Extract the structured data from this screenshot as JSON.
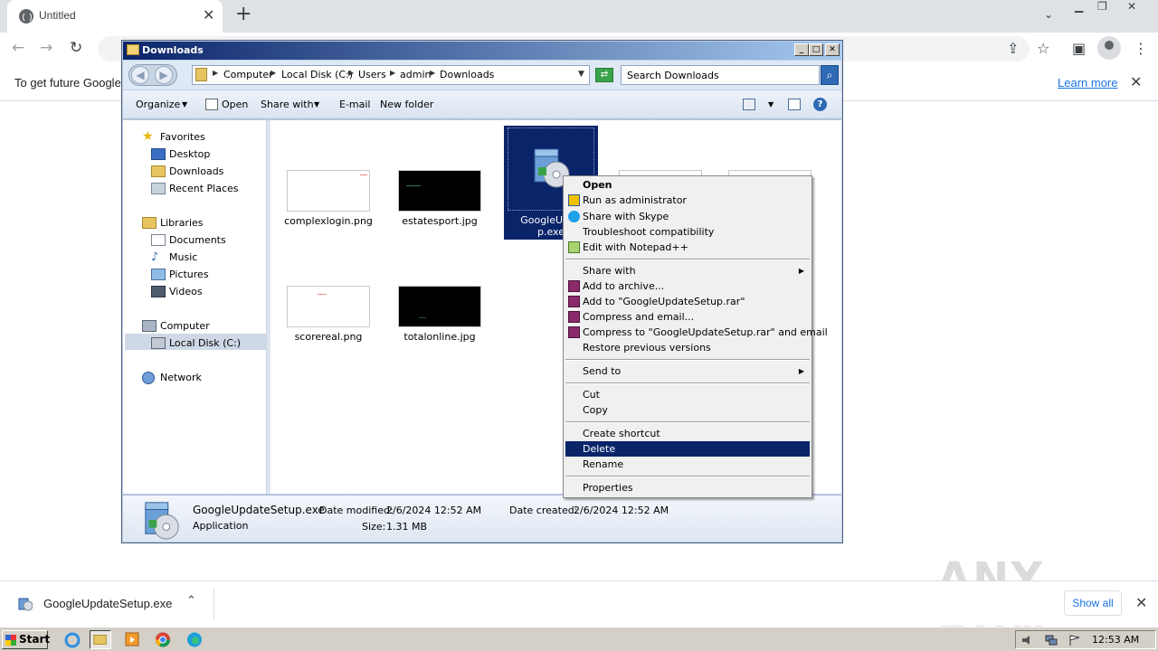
{
  "chrome": {
    "tab_title": "Untitled",
    "close_tab_glyph": "✕",
    "new_tab_glyph": "+",
    "infobar_message": "To get future Google",
    "infobar_link": "Learn more"
  },
  "explorer": {
    "title": "Downloads",
    "address": [
      "Computer",
      "Local Disk (C:)",
      "Users",
      "admin",
      "Downloads"
    ],
    "search_placeholder": "Search Downloads",
    "commands": {
      "organize": "Organize",
      "open": "Open",
      "share_with": "Share with",
      "email": "E-mail",
      "new_folder": "New folder"
    },
    "nav": {
      "favorites": "Favorites",
      "desktop": "Desktop",
      "downloads": "Downloads",
      "recent_places": "Recent Places",
      "libraries": "Libraries",
      "documents": "Documents",
      "music": "Music",
      "pictures": "Pictures",
      "videos": "Videos",
      "computer": "Computer",
      "local_disk": "Local Disk (C:)",
      "network": "Network"
    },
    "files": [
      {
        "name": "complexlogin.png"
      },
      {
        "name": "estatesport.jpg"
      },
      {
        "name": "GoogleUpdateSetup.exe",
        "display_line1": "GoogleUpda",
        "display_line2": "p.exe"
      },
      {
        "name": "scorereal.png"
      },
      {
        "name": "totalonline.jpg"
      }
    ],
    "details": {
      "filename": "GoogleUpdateSetup.exe",
      "type": "Application",
      "date_modified_label": "Date modified:",
      "date_modified": "2/6/2024 12:52 AM",
      "size_label": "Size:",
      "size": "1.31 MB",
      "date_created_label": "Date created:",
      "date_created": "2/6/2024 12:52 AM"
    }
  },
  "context_menu": {
    "open": "Open",
    "run_as_admin": "Run as administrator",
    "share_skype": "Share with Skype",
    "troubleshoot": "Troubleshoot compatibility",
    "edit_notepad": "Edit with Notepad++",
    "share_with": "Share with",
    "add_archive": "Add to archive...",
    "add_rar": "Add to \"GoogleUpdateSetup.rar\"",
    "compress_email": "Compress and email...",
    "compress_rar_email": "Compress to \"GoogleUpdateSetup.rar\" and email",
    "restore": "Restore previous versions",
    "send_to": "Send to",
    "cut": "Cut",
    "copy": "Copy",
    "create_shortcut": "Create shortcut",
    "delete": "Delete",
    "rename": "Rename",
    "properties": "Properties",
    "highlighted": "Delete"
  },
  "download_bar": {
    "filename": "GoogleUpdateSetup.exe",
    "show_all": "Show all",
    "watermark": "ANY RUN"
  },
  "taskbar": {
    "start": "Start",
    "clock": "12:53 AM"
  },
  "colors": {
    "selection": "#0a246a",
    "link": "#1a73e8"
  }
}
